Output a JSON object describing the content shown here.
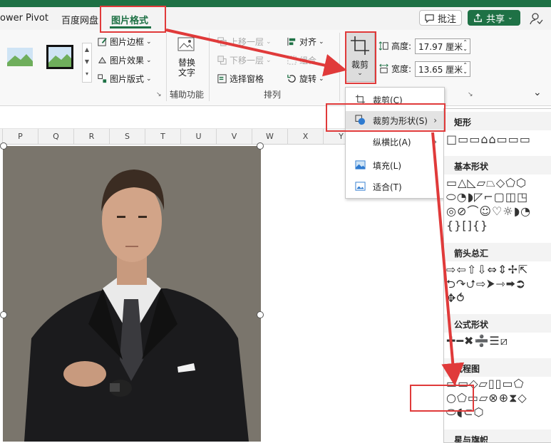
{
  "tabs": {
    "power_pivot": "ower Pivot",
    "baidu": "百度网盘",
    "picture_format": "图片格式"
  },
  "top_buttons": {
    "comment": "批注",
    "share": "共享"
  },
  "ribbon": {
    "picture_border": "图片边框",
    "picture_effects": "图片效果",
    "picture_layout": "图片版式",
    "alt_text": "替换\n文字",
    "accessibility_group": "辅助功能",
    "bring_forward": "上移一层",
    "send_backward": "下移一层",
    "selection_pane": "选择窗格",
    "align": "对齐",
    "group": "组合",
    "rotate": "旋转",
    "arrange_group": "排列",
    "crop": "裁剪",
    "height_label": "高度:",
    "height_value": "17.97 厘米",
    "width_label": "宽度:",
    "width_value": "13.65 厘米"
  },
  "columns": [
    "P",
    "Q",
    "R",
    "S",
    "T",
    "U",
    "V",
    "W",
    "X",
    "Y"
  ],
  "crop_menu": {
    "crop": "裁剪(C)",
    "crop_to_shape": "裁剪为形状(S)",
    "aspect_ratio": "纵横比(A)",
    "fill": "填充(L)",
    "fit": "适合(T)"
  },
  "shapes_panel": {
    "rectangles": "矩形",
    "basic_shapes": "基本形状",
    "block_arrows": "箭头总汇",
    "equation_shapes": "公式形状",
    "flowchart": "流程图",
    "stars_banners": "星与旗帜",
    "rect_row": "□▭▭⌂⌂▭▭▭",
    "basic_row1": "▭△◺▱⏢◇⬠⬡",
    "basic_row2": "⬭◔◗◸⌐▢◫◳",
    "basic_row3": "◎⊘⌒☺♡☼◗◔",
    "basic_row4": "{}[]{}",
    "arrow_row1": "⇨⇦⇧⇩⇔⇕✢⇱",
    "arrow_row2": "⮌↷⮍⇨⮞⇾⮕⮊",
    "arrow_row3": "✥⥀",
    "equation_row": "✚━✖➗☰⧄",
    "flow_row1": "▭▭◇▱▯▯▭⬠",
    "flow_row2": "○⬠▭▱⊗⊕⧗◇",
    "flow_row3": "⬭◖⊂⬡"
  },
  "colors": {
    "accent_green": "#1e7145",
    "annotation_red": "#e03a3a"
  }
}
